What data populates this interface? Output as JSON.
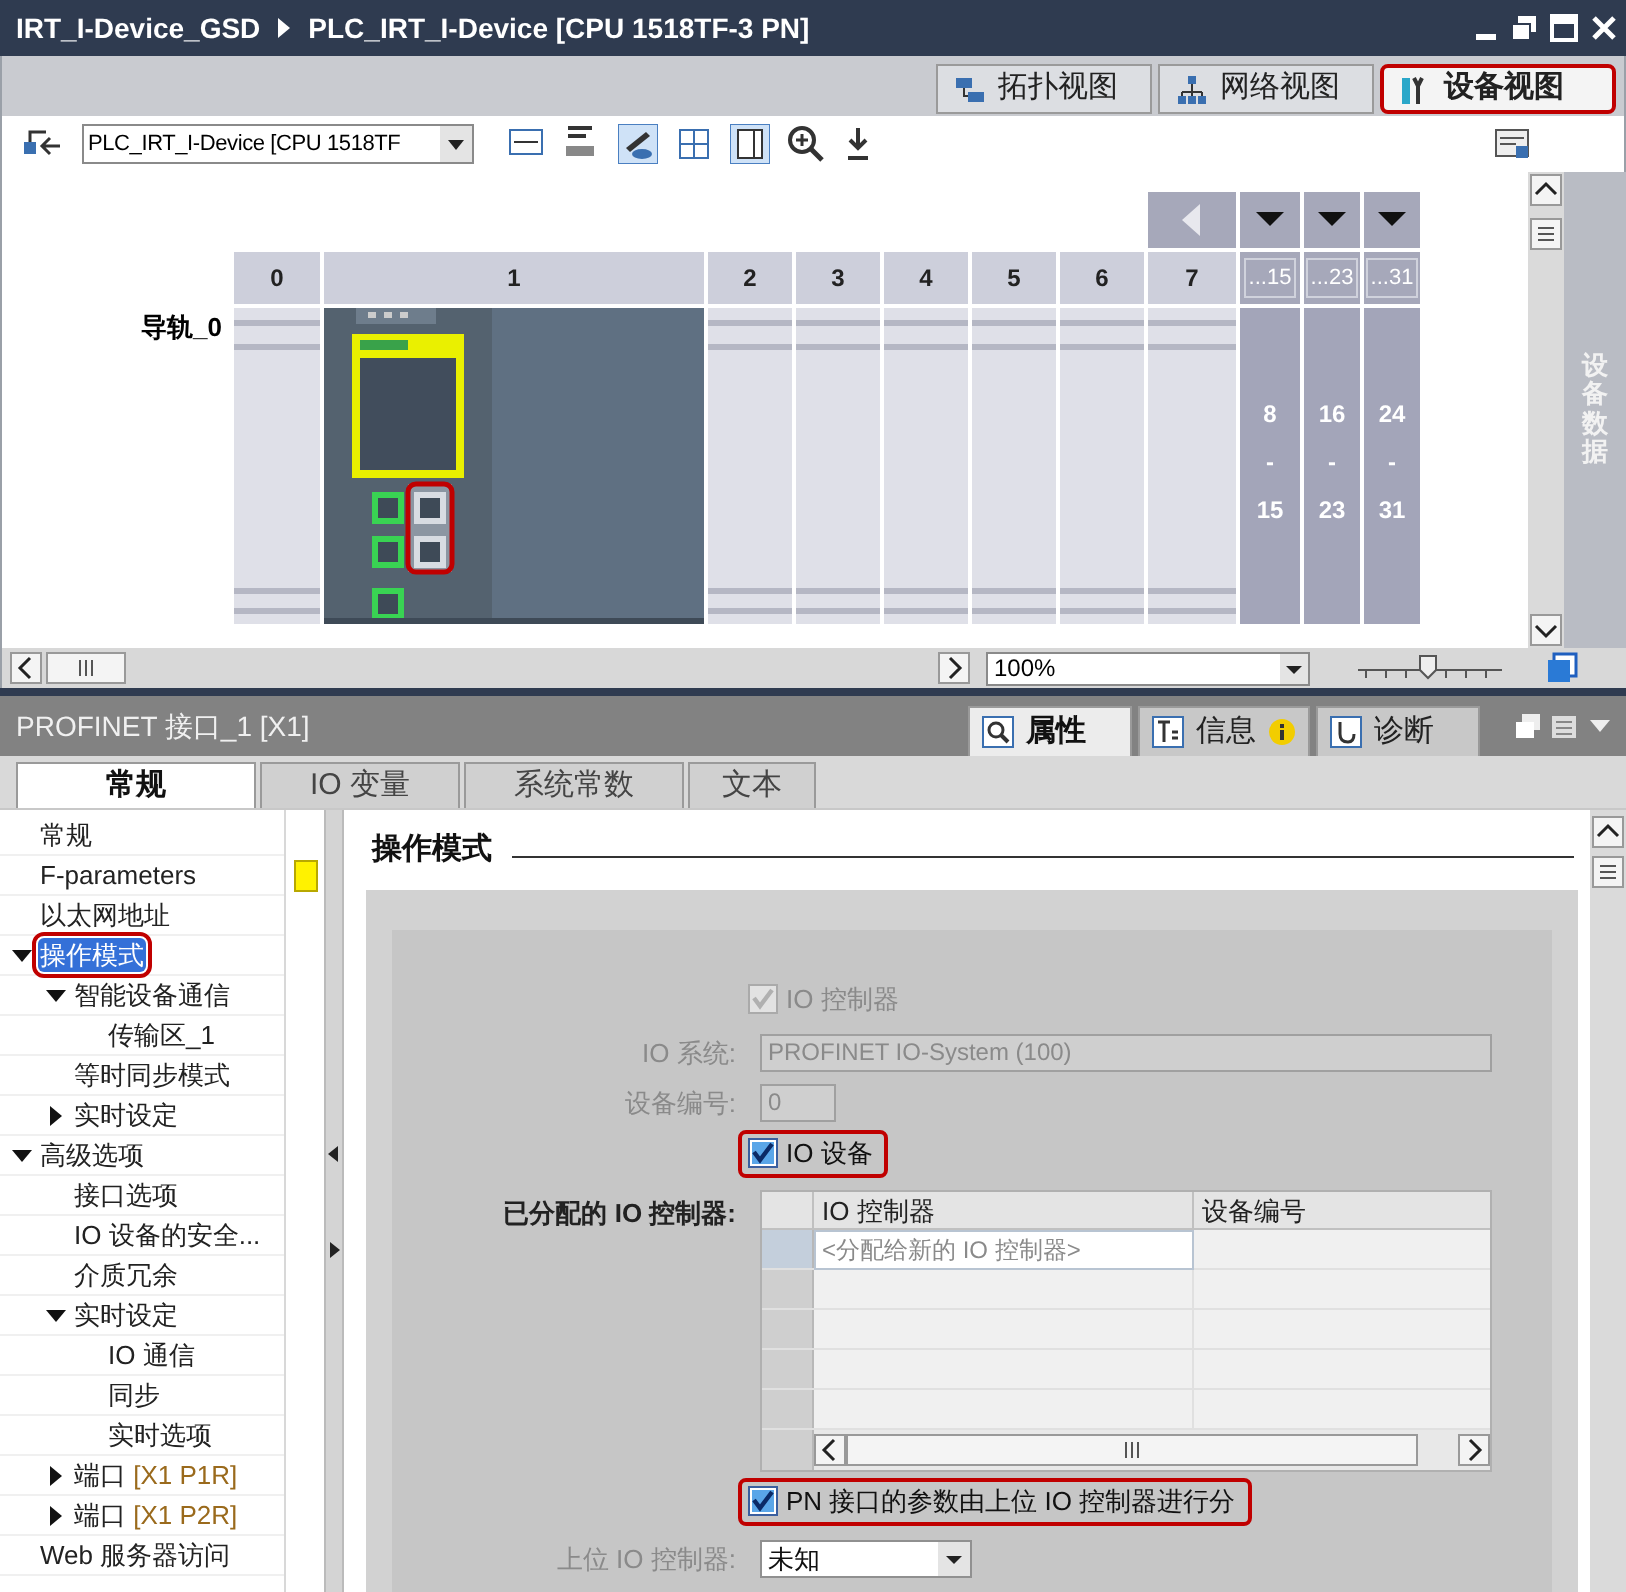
{
  "title_bar": {
    "breadcrumb": [
      "IRT_I-Device_GSD",
      "PLC_IRT_I-Device [CPU 1518TF-3 PN]"
    ]
  },
  "view_tabs": [
    {
      "label": "拓扑视图",
      "selected": false,
      "highlighted": false
    },
    {
      "label": "网络视图",
      "selected": false,
      "highlighted": false
    },
    {
      "label": "设备视图",
      "selected": true,
      "highlighted": true
    }
  ],
  "toolbar": {
    "device_select": "PLC_IRT_I-Device [CPU 1518TF"
  },
  "rack": {
    "rail_label": "导轨_0",
    "slots": [
      "0",
      "1",
      "2",
      "3",
      "4",
      "5",
      "6",
      "7"
    ],
    "ports_highlighted": true,
    "extra_slots": [
      {
        "header": "...15",
        "from": "8",
        "dash": "-",
        "to": "15"
      },
      {
        "header": "...23",
        "from": "16",
        "dash": "-",
        "to": "23"
      },
      {
        "header": "...31",
        "from": "24",
        "dash": "-",
        "to": "31"
      }
    ]
  },
  "side_tab": "设备数据",
  "zoom": {
    "value": "100%"
  },
  "inspector": {
    "title": "PROFINET 接口_1 [X1]",
    "tabs": [
      {
        "label": "属性",
        "selected": true
      },
      {
        "label": "信息",
        "selected": false
      },
      {
        "label": "诊断",
        "selected": false
      }
    ],
    "subtabs": [
      {
        "label": "常规",
        "selected": true
      },
      {
        "label": "IO 变量",
        "selected": false
      },
      {
        "label": "系统常数",
        "selected": false
      },
      {
        "label": "文本",
        "selected": false
      }
    ],
    "nav": [
      {
        "label": "常规",
        "selected": false,
        "flagged": false,
        "highlighted": false
      },
      {
        "label": "F-parameters",
        "selected": false,
        "flagged": true,
        "highlighted": false
      },
      {
        "label": "以太网地址",
        "selected": false,
        "flagged": false,
        "highlighted": false
      },
      {
        "label": "操作模式",
        "expanded": true,
        "selected": true,
        "flagged": false,
        "highlighted": true,
        "children": [
          {
            "label": "智能设备通信",
            "expanded": true,
            "selected": false,
            "flagged": false,
            "highlighted": false,
            "children": [
              {
                "label": "传输区_1",
                "selected": false,
                "flagged": false,
                "highlighted": false
              }
            ]
          },
          {
            "label": "等时同步模式",
            "selected": false,
            "flagged": false,
            "highlighted": false
          },
          {
            "label": "实时设定",
            "expanded": false,
            "selected": false,
            "flagged": false,
            "highlighted": false
          }
        ]
      },
      {
        "label": "高级选项",
        "expanded": true,
        "selected": false,
        "flagged": false,
        "highlighted": false,
        "children": [
          {
            "label": "接口选项",
            "selected": false,
            "flagged": false,
            "highlighted": false
          },
          {
            "label": "IO 设备的安全...",
            "selected": false,
            "flagged": false,
            "highlighted": false
          },
          {
            "label": "介质冗余",
            "selected": false,
            "flagged": false,
            "highlighted": false
          },
          {
            "label": "实时设定",
            "expanded": true,
            "selected": false,
            "flagged": false,
            "highlighted": false,
            "children": [
              {
                "label": "IO 通信",
                "selected": false,
                "flagged": false,
                "highlighted": false
              },
              {
                "label": "同步",
                "selected": false,
                "flagged": false,
                "highlighted": false
              },
              {
                "label": "实时选项",
                "selected": false,
                "flagged": false,
                "highlighted": false
              }
            ]
          },
          {
            "label": "端口",
            "suffix": "[X1 P1R]",
            "expanded": false,
            "selected": false,
            "flagged": false,
            "highlighted": false
          },
          {
            "label": "端口",
            "suffix": "[X1 P2R]",
            "expanded": false,
            "selected": false,
            "flagged": false,
            "highlighted": false
          }
        ]
      },
      {
        "label": "Web 服务器访问",
        "selected": false,
        "flagged": false,
        "highlighted": false
      }
    ],
    "section_title": "操作模式",
    "form": {
      "io_controller": {
        "label": "IO 控制器",
        "checked": true,
        "disabled": true,
        "highlighted": false
      },
      "io_system": {
        "label": "IO 系统:",
        "value": "PROFINET IO-System (100)"
      },
      "device_number": {
        "label": "设备编号:",
        "value": "0"
      },
      "io_device": {
        "label": "IO 设备",
        "checked": true,
        "disabled": false,
        "highlighted": true
      },
      "assigned_controllers": {
        "label": "已分配的 IO 控制器:",
        "columns": [
          "IO 控制器",
          "设备编号"
        ],
        "new_entry_placeholder": "<分配给新的 IO 控制器>"
      },
      "pn_params": {
        "label": "PN 接口的参数由上位 IO 控制器进行分",
        "checked": true,
        "disabled": false,
        "highlighted": true
      },
      "upper_controller": {
        "label": "上位 IO 控制器:",
        "value": "未知"
      }
    }
  }
}
